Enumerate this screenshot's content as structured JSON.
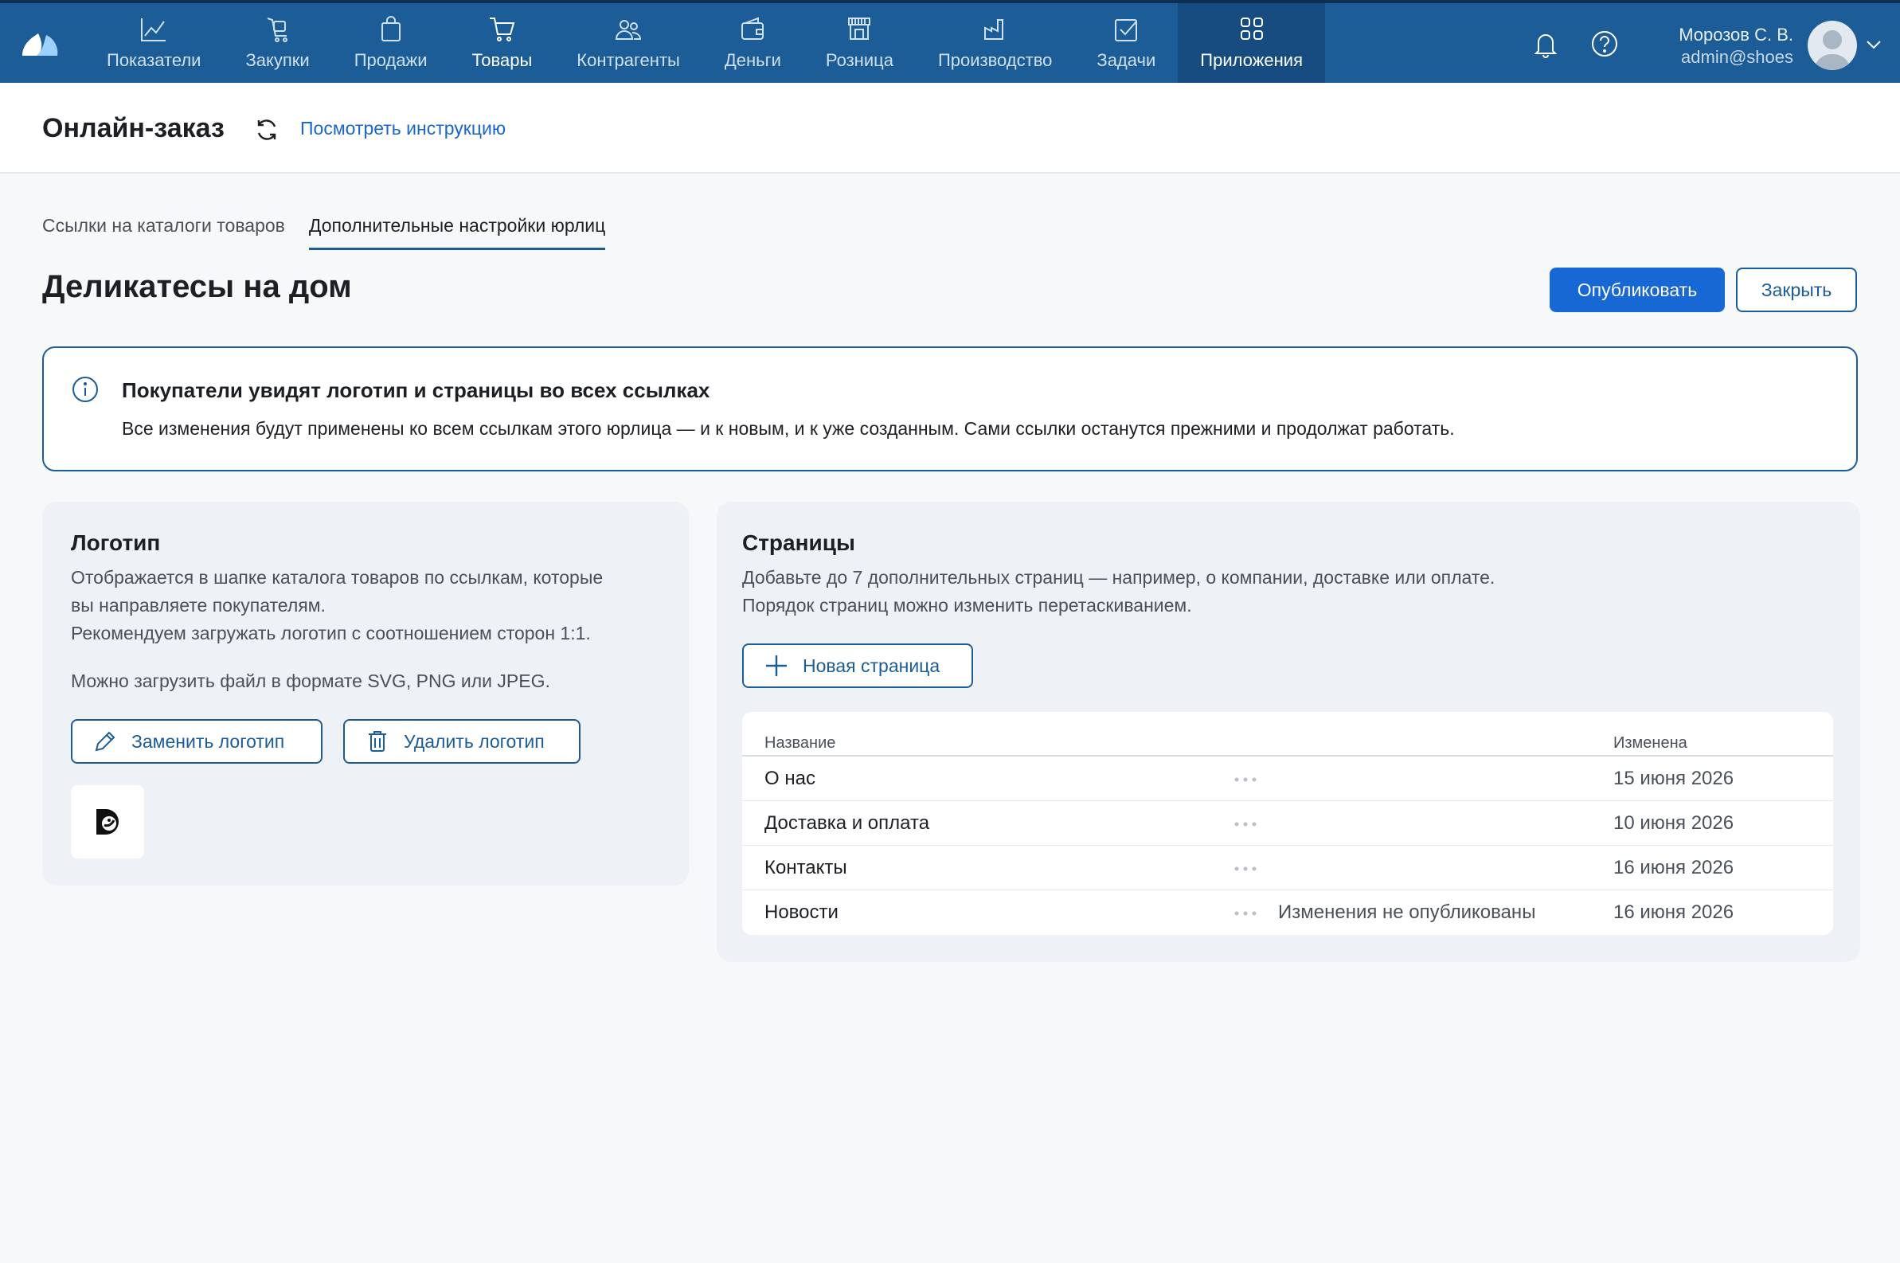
{
  "nav": {
    "items": [
      {
        "label": "Показатели",
        "icon": "chart-line-icon"
      },
      {
        "label": "Закупки",
        "icon": "cart-hand-icon"
      },
      {
        "label": "Продажи",
        "icon": "shopping-bag-icon"
      },
      {
        "label": "Товары",
        "icon": "cart-icon"
      },
      {
        "label": "Контрагенты",
        "icon": "users-icon"
      },
      {
        "label": "Деньги",
        "icon": "wallet-icon"
      },
      {
        "label": "Розница",
        "icon": "storefront-icon"
      },
      {
        "label": "Производство",
        "icon": "factory-icon"
      },
      {
        "label": "Задачи",
        "icon": "checkbox-icon"
      },
      {
        "label": "Приложения",
        "icon": "apps-grid-icon"
      }
    ],
    "selected": "Товары",
    "active": "Приложения"
  },
  "user": {
    "name": "Морозов С. В.",
    "email": "admin@shoes"
  },
  "header": {
    "title": "Онлайн-заказ",
    "instruction_link": "Посмотреть инструкцию"
  },
  "tabs": [
    {
      "label": "Ссылки на каталоги товаров",
      "active": false
    },
    {
      "label": "Дополнительные настройки юрлиц",
      "active": true
    }
  ],
  "section": {
    "title": "Деликатесы на дом",
    "publish": "Опубликовать",
    "close": "Закрыть"
  },
  "banner": {
    "title": "Покупатели увидят логотип и страницы во всех ссылках",
    "text": "Все изменения будут применены ко всем ссылкам этого юрлица — и к новым, и к уже созданным. Сами ссылки останутся прежними и продолжат работать."
  },
  "logo_card": {
    "title": "Логотип",
    "description_1": "Отображается в шапке каталога товаров по ссылкам, которые",
    "description_2": "вы направляете покупателям.",
    "description_3": "Рекомендуем загружать логотип с соотношением сторон 1:1.",
    "formats": "Можно загрузить файл в формате SVG, PNG или JPEG.",
    "replace_button": "Заменить логотип",
    "delete_button": "Удалить логотип"
  },
  "pages_card": {
    "title": "Страницы",
    "description_1": "Добавьте до 7 дополнительных страниц — например, о компании, доставке или оплате.",
    "description_2": "Порядок страниц можно изменить перетаскиванием.",
    "new_page_button": "Новая страница",
    "columns": {
      "name": "Название",
      "modified": "Изменена"
    },
    "rows": [
      {
        "name": "О нас",
        "status": "",
        "date": "15 июня 2026"
      },
      {
        "name": "Доставка и оплата",
        "status": "",
        "date": "10 июня 2026"
      },
      {
        "name": "Контакты",
        "status": "",
        "date": "16 июня 2026"
      },
      {
        "name": "Новости",
        "status": "Изменения не опубликованы",
        "date": "16 июня 2026"
      }
    ]
  },
  "colors": {
    "topbar": "#1c5c97",
    "primary": "#1768d4",
    "accent": "#1c5c97"
  }
}
